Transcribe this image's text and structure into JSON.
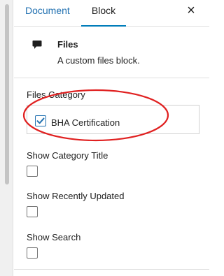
{
  "tabs": {
    "document_label": "Document",
    "block_label": "Block"
  },
  "close_symbol": "×",
  "block": {
    "title": "Files",
    "description": "A custom files block.",
    "icon": "speech-bubble-icon"
  },
  "files_category": {
    "label": "Files Category",
    "options": [
      {
        "name": "BHA Certification",
        "checked": true
      }
    ]
  },
  "settings": {
    "show_category_title": {
      "label": "Show Category Title",
      "checked": false
    },
    "show_recently_updated": {
      "label": "Show Recently Updated",
      "checked": false
    },
    "show_search": {
      "label": "Show Search",
      "checked": false
    }
  },
  "colors": {
    "accent": "#2271b1",
    "annotation": "#e02020"
  }
}
